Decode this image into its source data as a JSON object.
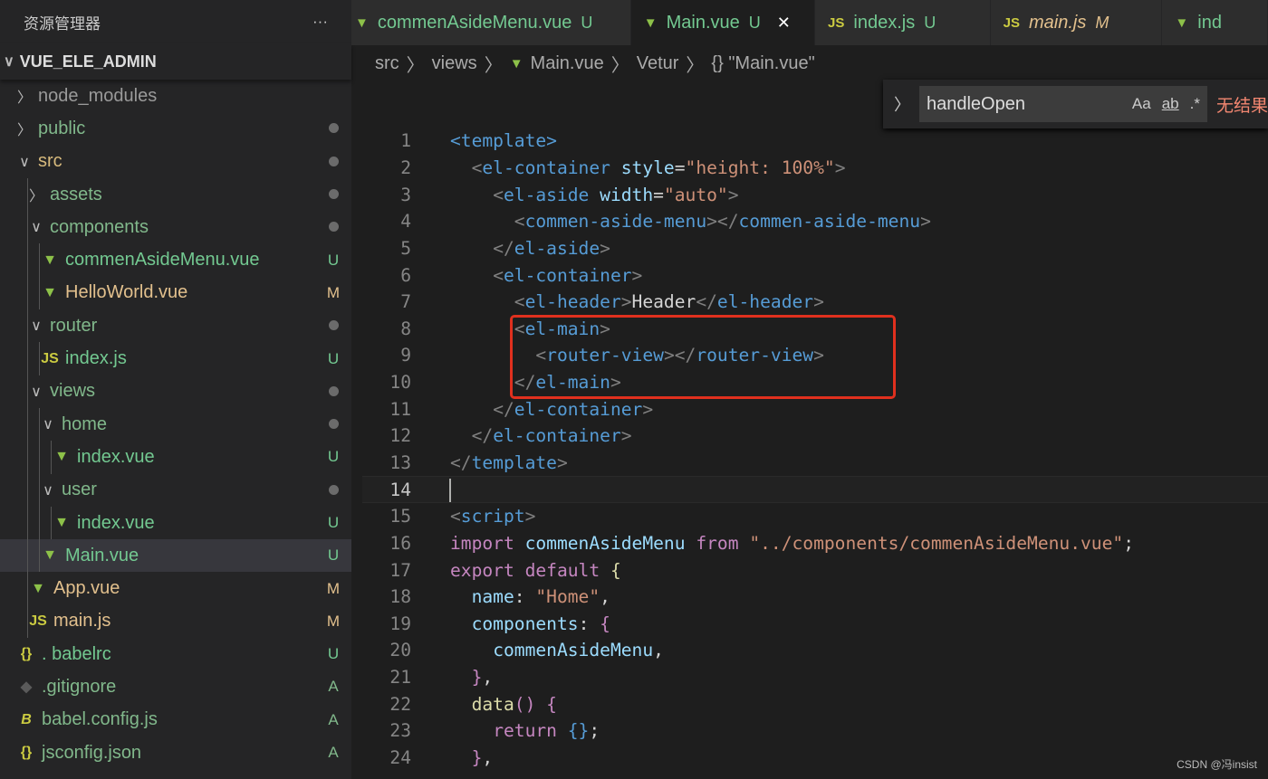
{
  "sidebar": {
    "title": "资源管理器",
    "more": "···",
    "project": "VUE_ELE_ADMIN",
    "items": [
      {
        "depth": 0,
        "kind": "folder",
        "name": "node_modules",
        "open": false,
        "color": "#9a9a9a",
        "status": ""
      },
      {
        "depth": 0,
        "kind": "folder",
        "name": "public",
        "open": false,
        "color": "#81b88b",
        "status": "dot"
      },
      {
        "depth": 0,
        "kind": "folder",
        "name": "src",
        "open": true,
        "color": "#d7ba7d",
        "status": "dot"
      },
      {
        "depth": 1,
        "kind": "folder",
        "name": "assets",
        "open": false,
        "color": "#81b88b",
        "status": "dot"
      },
      {
        "depth": 1,
        "kind": "folder",
        "name": "components",
        "open": true,
        "color": "#81b88b",
        "status": "dot"
      },
      {
        "depth": 2,
        "kind": "vue",
        "name": "commenAsideMenu.vue",
        "color": "#73c991",
        "status": "U"
      },
      {
        "depth": 2,
        "kind": "vue",
        "name": "HelloWorld.vue",
        "color": "#e2c08d",
        "status": "M"
      },
      {
        "depth": 1,
        "kind": "folder",
        "name": "router",
        "open": true,
        "color": "#81b88b",
        "status": "dot"
      },
      {
        "depth": 2,
        "kind": "js",
        "name": "index.js",
        "color": "#73c991",
        "status": "U"
      },
      {
        "depth": 1,
        "kind": "folder",
        "name": "views",
        "open": true,
        "color": "#81b88b",
        "status": "dot"
      },
      {
        "depth": 2,
        "kind": "folder",
        "name": "home",
        "open": true,
        "color": "#81b88b",
        "status": "dot"
      },
      {
        "depth": 3,
        "kind": "vue",
        "name": "index.vue",
        "color": "#73c991",
        "status": "U"
      },
      {
        "depth": 2,
        "kind": "folder",
        "name": "user",
        "open": true,
        "color": "#81b88b",
        "status": "dot"
      },
      {
        "depth": 3,
        "kind": "vue",
        "name": "index.vue",
        "color": "#73c991",
        "status": "U"
      },
      {
        "depth": 2,
        "kind": "vue",
        "name": "Main.vue",
        "color": "#73c991",
        "status": "U",
        "selected": true
      },
      {
        "depth": 1,
        "kind": "vue",
        "name": "App.vue",
        "color": "#e2c08d",
        "status": "M"
      },
      {
        "depth": 1,
        "kind": "js",
        "name": "main.js",
        "color": "#e2c08d",
        "status": "M"
      },
      {
        "depth": 0,
        "kind": "json",
        "name": ". babelrc",
        "color": "#73c991",
        "status": "U"
      },
      {
        "depth": 0,
        "kind": "git",
        "name": ".gitignore",
        "color": "#81b88b",
        "status": "A"
      },
      {
        "depth": 0,
        "kind": "babel",
        "name": "babel.config.js",
        "color": "#81b88b",
        "status": "A"
      },
      {
        "depth": 0,
        "kind": "json",
        "name": "jsconfig.json",
        "color": "#81b88b",
        "status": "A"
      }
    ]
  },
  "icons": {
    "vue": "▼",
    "js": "JS",
    "json": "{}",
    "git": "◆",
    "babel": "B"
  },
  "icon_colors": {
    "vue": "#8dc149",
    "js": "#cbcb41",
    "json": "#cbcb41",
    "git": "#5a5a5a",
    "babel": "#cbcb41"
  },
  "tabs": [
    {
      "kind": "vue",
      "label": "commenAsideMenu.vue",
      "badge": "U",
      "color": "#73c991"
    },
    {
      "kind": "vue",
      "label": "Main.vue",
      "badge": "U",
      "color": "#73c991",
      "active": true,
      "close": "✕"
    },
    {
      "kind": "js",
      "label": "index.js",
      "badge": "U",
      "color": "#73c991"
    },
    {
      "kind": "js",
      "label": "main.js",
      "badge": "M",
      "color": "#e2c08d",
      "italic": true
    },
    {
      "kind": "vue",
      "label": "ind",
      "badge": "",
      "color": "#73c991"
    }
  ],
  "breadcrumb": [
    "src",
    "views",
    "Main.vue",
    "Vetur",
    "{} \"Main.vue\""
  ],
  "find": {
    "value": "handleOpen",
    "match_case": "Aa",
    "whole_word": "ab",
    "regex": ".*",
    "result": "无结果"
  },
  "code": [
    [
      [
        "tag",
        "<template>"
      ]
    ],
    [
      [
        "t",
        "  "
      ],
      [
        "br",
        "<"
      ],
      [
        "tag",
        "el-container"
      ],
      [
        "t",
        " "
      ],
      [
        "attr",
        "style"
      ],
      [
        "t",
        "="
      ],
      [
        "str",
        "\"height: 100%\""
      ],
      [
        "br",
        ">"
      ]
    ],
    [
      [
        "t",
        "    "
      ],
      [
        "br",
        "<"
      ],
      [
        "tag",
        "el-aside"
      ],
      [
        "t",
        " "
      ],
      [
        "attr",
        "width"
      ],
      [
        "t",
        "="
      ],
      [
        "str",
        "\"auto\""
      ],
      [
        "br",
        ">"
      ]
    ],
    [
      [
        "t",
        "      "
      ],
      [
        "br",
        "<"
      ],
      [
        "tag",
        "commen-aside-menu"
      ],
      [
        "br",
        "></"
      ],
      [
        "tag",
        "commen-aside-menu"
      ],
      [
        "br",
        ">"
      ]
    ],
    [
      [
        "t",
        "    "
      ],
      [
        "br",
        "</"
      ],
      [
        "tag",
        "el-aside"
      ],
      [
        "br",
        ">"
      ]
    ],
    [
      [
        "t",
        "    "
      ],
      [
        "br",
        "<"
      ],
      [
        "tag",
        "el-container"
      ],
      [
        "br",
        ">"
      ]
    ],
    [
      [
        "t",
        "      "
      ],
      [
        "br",
        "<"
      ],
      [
        "tag",
        "el-header"
      ],
      [
        "br",
        ">"
      ],
      [
        "t",
        "Header"
      ],
      [
        "br",
        "</"
      ],
      [
        "tag",
        "el-header"
      ],
      [
        "br",
        ">"
      ]
    ],
    [
      [
        "t",
        "      "
      ],
      [
        "br",
        "<"
      ],
      [
        "tag",
        "el-main"
      ],
      [
        "br",
        ">"
      ]
    ],
    [
      [
        "t",
        "        "
      ],
      [
        "br",
        "<"
      ],
      [
        "tag",
        "router-view"
      ],
      [
        "br",
        "></"
      ],
      [
        "tag",
        "router-view"
      ],
      [
        "br",
        ">"
      ]
    ],
    [
      [
        "t",
        "      "
      ],
      [
        "br",
        "</"
      ],
      [
        "tag",
        "el-main"
      ],
      [
        "br",
        ">"
      ]
    ],
    [
      [
        "t",
        "    "
      ],
      [
        "br",
        "</"
      ],
      [
        "tag",
        "el-container"
      ],
      [
        "br",
        ">"
      ]
    ],
    [
      [
        "t",
        "  "
      ],
      [
        "br",
        "</"
      ],
      [
        "tag",
        "el-container"
      ],
      [
        "br",
        ">"
      ]
    ],
    [
      [
        "br",
        "</"
      ],
      [
        "tag",
        "template"
      ],
      [
        "br",
        ">"
      ]
    ],
    [],
    [
      [
        "br",
        "<"
      ],
      [
        "tag",
        "script"
      ],
      [
        "br",
        ">"
      ]
    ],
    [
      [
        "kw",
        "import"
      ],
      [
        "t",
        " "
      ],
      [
        "id",
        "commenAsideMenu"
      ],
      [
        "t",
        " "
      ],
      [
        "kw",
        "from"
      ],
      [
        "t",
        " "
      ],
      [
        "str",
        "\"../components/commenAsideMenu.vue\""
      ],
      [
        "t",
        ";"
      ]
    ],
    [
      [
        "kw",
        "export"
      ],
      [
        "t",
        " "
      ],
      [
        "kw",
        "default"
      ],
      [
        "t",
        " "
      ],
      [
        "fn",
        "{"
      ]
    ],
    [
      [
        "t",
        "  "
      ],
      [
        "id",
        "name"
      ],
      [
        "t",
        ": "
      ],
      [
        "str",
        "\"Home\""
      ],
      [
        "t",
        ","
      ]
    ],
    [
      [
        "t",
        "  "
      ],
      [
        "id",
        "components"
      ],
      [
        "t",
        ": "
      ],
      [
        "kw",
        "{"
      ]
    ],
    [
      [
        "t",
        "    "
      ],
      [
        "id",
        "commenAsideMenu"
      ],
      [
        "t",
        ","
      ]
    ],
    [
      [
        "t",
        "  "
      ],
      [
        "kw",
        "}"
      ],
      [
        "t",
        ","
      ]
    ],
    [
      [
        "t",
        "  "
      ],
      [
        "fn",
        "data"
      ],
      [
        "kw",
        "()"
      ],
      [
        "t",
        " "
      ],
      [
        "kw",
        "{"
      ]
    ],
    [
      [
        "t",
        "    "
      ],
      [
        "kw",
        "return"
      ],
      [
        "t",
        " "
      ],
      [
        "tag",
        "{}"
      ],
      [
        "t",
        ";"
      ]
    ],
    [
      [
        "t",
        "  "
      ],
      [
        "kw",
        "}"
      ],
      [
        "t",
        ","
      ]
    ]
  ],
  "current_line": 14,
  "watermark": "CSDN @冯insist"
}
